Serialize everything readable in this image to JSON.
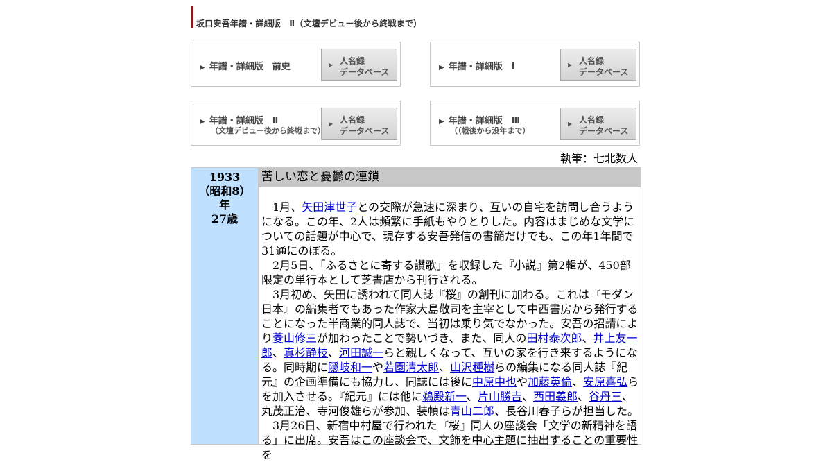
{
  "header": {
    "title": "坂口安吾年譜・詳細版　Ⅱ（文壇デビュー後から終戦まで）",
    "accent_color": "#8b1a1a"
  },
  "nav": [
    {
      "main": "年譜・詳細版　前史",
      "sub": "",
      "db_l1": "人名録",
      "db_l2": "データベース"
    },
    {
      "main": "年譜・詳細版　Ⅰ",
      "sub": "",
      "db_l1": "人名録",
      "db_l2": "データベース"
    },
    {
      "main": "年譜・詳細版　Ⅱ",
      "sub": "（文壇デビュー後から終戦まで）",
      "db_l1": "人名録",
      "db_l2": "データベース"
    },
    {
      "main": "年譜・詳細版　Ⅲ",
      "sub": "（（戦後から没年まで）",
      "db_l1": "人名録",
      "db_l2": "データベース"
    }
  ],
  "author": "執筆：七北数人",
  "entry": {
    "year": "1933",
    "era": "（昭和8）",
    "nen": "年",
    "age": "27歳",
    "title": "苦しい恋と憂鬱の連鎖",
    "year_bg": "#bfe0ff",
    "p1_a": "1月、",
    "p1_link1": "矢田津世子",
    "p1_b": "との交際が急速に深まり、互いの自宅を訪問し合うようになる。この年、2人は頻繁に手紙もやりとりした。内容はまじめな文学についての話題が中心で、現存する安吾発信の書簡だけでも、この年1年間で31通にのぼる。",
    "p2": "2月5日、「ふるさとに寄する讃歌」を収録した『小説』第2輯が、450部限定の単行本として芝書店から刊行される。",
    "p3_a": "3月初め、矢田に誘われて同人誌『桜』の創刊に加わる。これは『モダン日本』の編集者でもあった作家大島敬司を主宰として中西書房から発行することになった半商業的同人誌で、当初は乗り気でなかった。安吾の招請により",
    "l_hishiyama": "菱山修三",
    "p3_b": "が加わったことで勢いづき、また、同人の",
    "l_tamura": "田村泰次郎",
    "sep1": "、",
    "l_inoue": "井上友一郎",
    "sep2": "、",
    "l_masugi": "真杉静枝",
    "sep3": "、",
    "l_kawada": "河田誠一",
    "p3_c": "らと親しくなって、互いの家を行き来するようになる。同時期に",
    "l_oki": "隠岐和一",
    "p3_d": "や",
    "l_wakazono": "若園清太郎",
    "sep4": "、",
    "l_yamazawa": "山沢種樹",
    "p3_e": "らの編集になる同人誌『紀元』の企画準備にも協力し、同誌には後に",
    "l_nakahara": "中原中也",
    "p3_f": "や",
    "l_kato": "加藤英倫",
    "sep5": "、",
    "l_yasuhara": "安原喜弘",
    "p3_g": "らを加入させる。『紀元』には他に",
    "l_udono": "鵜殿新一",
    "sep6": "、",
    "l_katayama": "片山勝吉",
    "sep7": "、",
    "l_nishida": "西田義郎",
    "sep8": "、",
    "l_tani": "谷丹三",
    "p3_h": "、丸茂正治、寺河俊雄らが参加、装幀は",
    "l_aoyama": "青山二郎",
    "p3_i": "、長谷川春子らが担当した。",
    "p4": "3月26日、新宿中村屋で行われた『桜』同人の座談会「文学の新精神を語る」に出席。安吾はこの座談会で、文飾を中心主題に抽出することの重要性を"
  }
}
